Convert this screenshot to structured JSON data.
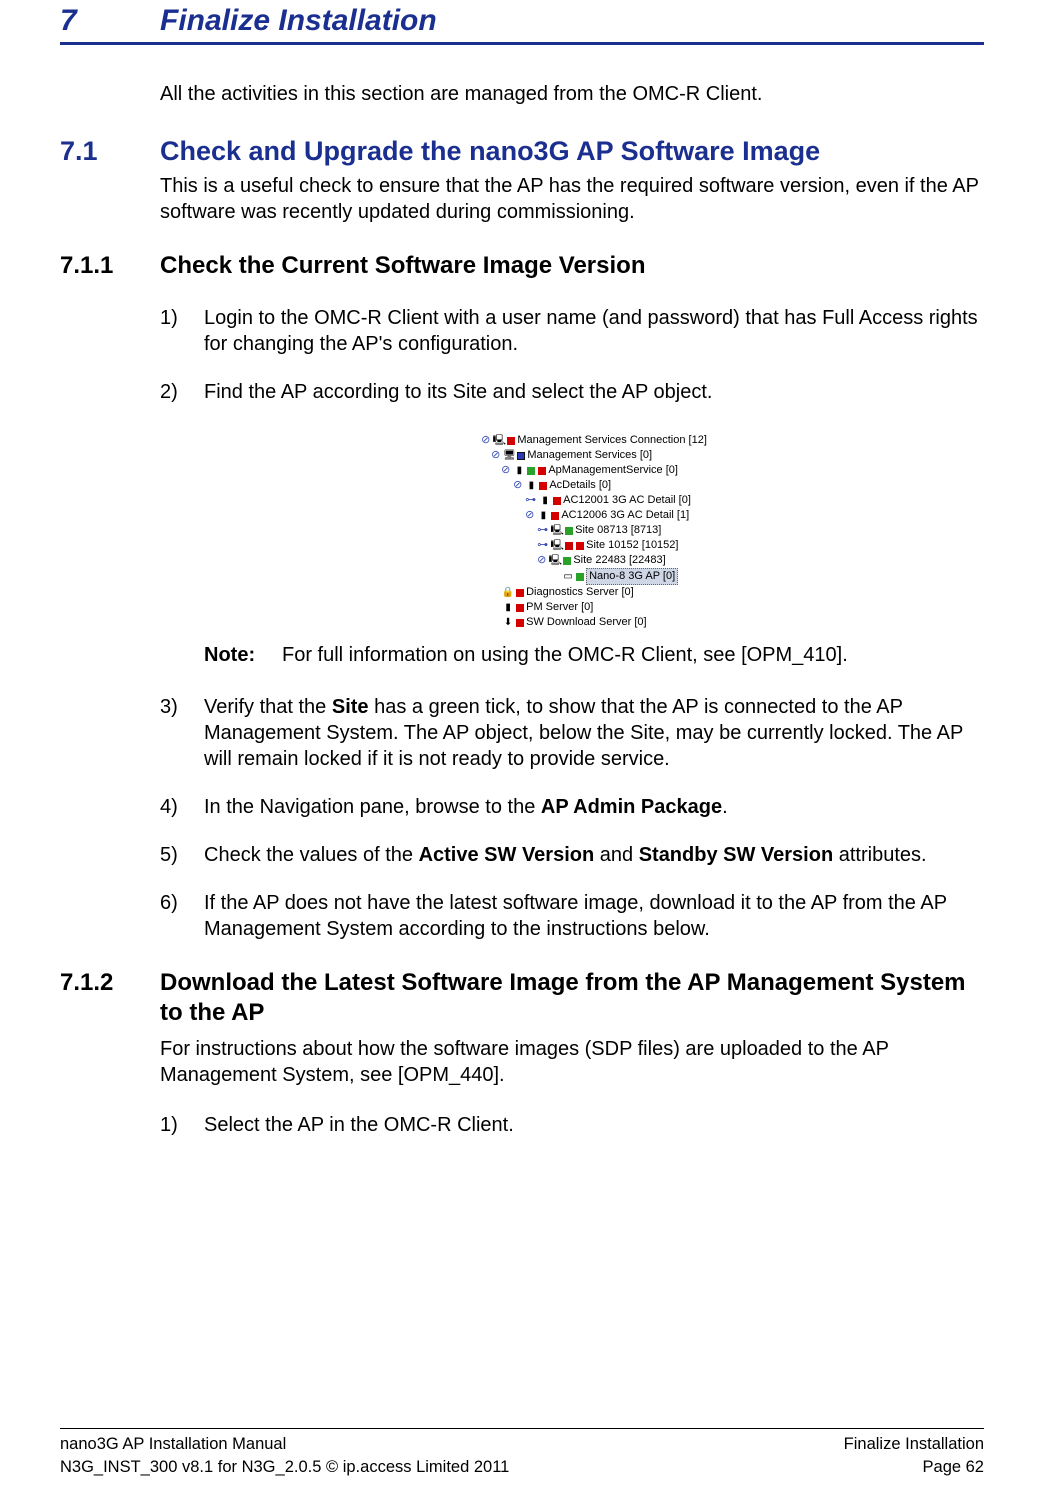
{
  "chapter": {
    "num": "7",
    "title": "Finalize Installation"
  },
  "intro": "All the activities in this section are managed from the OMC-R Client.",
  "s71": {
    "num": "7.1",
    "title": "Check and Upgrade the nano3G AP Software Image",
    "desc": "This is a useful check to ensure that the AP has the required software version, even if the AP software was recently updated during commissioning."
  },
  "s711": {
    "num": "7.1.1",
    "title": "Check the Current Software Image Version",
    "steps": {
      "n1": "1)",
      "t1": "Login to the OMC-R Client with a user name (and password) that has Full Access rights for changing the AP's configuration.",
      "n2": "2)",
      "t2": "Find the AP according to its Site and select the AP object.",
      "note_label": "Note:",
      "note_text": "For full information on using the OMC-R Client, see [OPM_410].",
      "n3": "3)",
      "t3a": "Verify that the ",
      "t3b": "Site",
      "t3c": " has a green tick, to show that the AP is connected to the AP Management System. The AP object, below the Site, may be currently locked. The AP will remain locked if it is not ready to provide service.",
      "n4": "4)",
      "t4a": "In the Navigation pane, browse to the ",
      "t4b": "AP Admin Package",
      "t4c": ".",
      "n5": "5)",
      "t5a": "Check the values of the ",
      "t5b": "Active SW Version",
      "t5c": " and ",
      "t5d": "Standby SW Version",
      "t5e": " attributes.",
      "n6": "6)",
      "t6": "If the AP does not have the latest software image, download it to the AP from the AP Management System according to the instructions below."
    }
  },
  "tree": {
    "l1": "Management Services Connection [12]",
    "l2": "Management Services [0]",
    "l3": "ApManagementService [0]",
    "l4": "AcDetails [0]",
    "l5": "AC12001 3G AC Detail [0]",
    "l6": "AC12006 3G AC Detail [1]",
    "l7": "Site 08713 [8713]",
    "l8": "Site 10152 [10152]",
    "l9": "Site 22483 [22483]",
    "l10": "Nano-8 3G AP [0]",
    "l11": "Diagnostics Server [0]",
    "l12": "PM Server [0]",
    "l13": "SW Download Server [0]"
  },
  "s712": {
    "num": "7.1.2",
    "title": "Download the Latest Software Image from the AP Management System to the AP",
    "desc": "For instructions about how the software images (SDP files) are uploaded to the AP Management System, see [OPM_440].",
    "steps": {
      "n1": "1)",
      "t1": "Select the AP in the OMC-R Client."
    }
  },
  "footer": {
    "left1": "nano3G AP Installation Manual",
    "left2": "N3G_INST_300 v8.1 for N3G_2.0.5 © ip.access Limited 2011",
    "right1": "Finalize Installation",
    "right2": "Page 62"
  }
}
